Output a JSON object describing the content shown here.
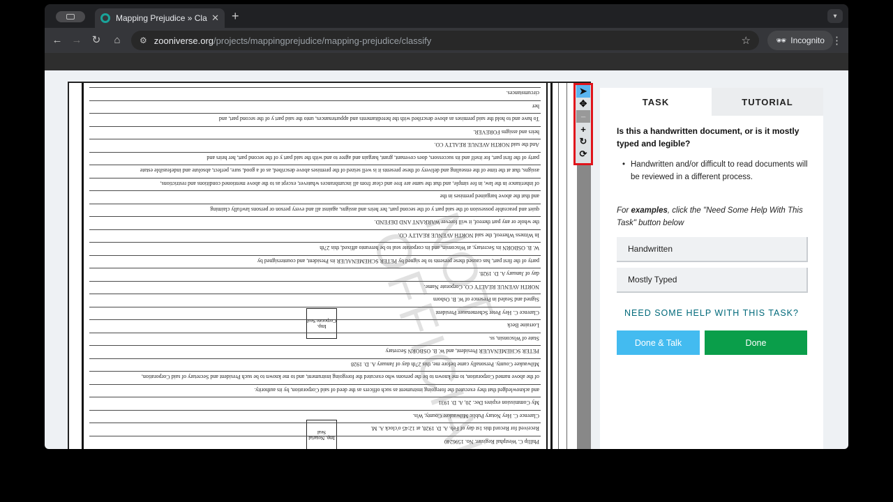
{
  "browser": {
    "tab_title": "Mapping Prejudice » Classify",
    "tab_close": "✕",
    "new_tab": "+",
    "url_domain": "zooniverse.org",
    "url_path": "/projects/mappingprejudice/mapping-prejudice/classify",
    "incognito_label": "Incognito"
  },
  "tools": [
    "pointer-icon",
    "move-icon",
    "zoom-out-icon",
    "zoom-in-icon",
    "rotate-icon",
    "reset-icon"
  ],
  "document": {
    "lines": [
      "Phillip C. Westphal    Register.    No. 1596240",
      "Received for Record this  1st  day of  Feb.  A. D. 1928, at 12:45 o'clock A. M.",
      "Clarence C. Hey        Notary Public Milwaukee County, Wis.",
      "My Commission expires Dec. 20, A. D. 1931",
      "and acknowledged that they executed the foregoing instrument as such officers as the deed of said Corporation, by its authority.",
      "of the above named Corporation, to me known to be the persons who executed the foregoing instrument, and to me known to be such President and Secretary of said Corporation,",
      "Milwaukee County.  Personally came before me, this 27th day of January A. D. 1928",
      "PETER SCHEMENAUER President, and W. B. OSBORN Secretary",
      "State of Wisconsin, ss.",
      "Lorraine Beck",
      "Clarence C. Hey         Peter Schemenauer   President",
      "Signed and Sealed in Presence of       W. B. Osborn",
      "NORTH AVENUE REALTY CO.      Corporate Name.",
      "day of January A. D. 1928.",
      "party of the first part, has caused these presents to be signed by PETER SCHEMENAUER its President, and countersigned by",
      "W. B. OSBORN its Secretary, at Wisconsin, and its corporate seal to be hereunto affixed, this 27th",
      "In Witness Whereof, the said NORTH AVENUE REALTY CO.",
      "the whole or any part thereof, it will forever WARRANT AND DEFEND.",
      "quiet and peaceable possession of the said part y of the second part, her heirs and assigns, against all and every person or persons lawfully claiming",
      "and that the above bargained premises in the",
      "of inheritance in the law, in fee simple, and that the same are free and clear from all incumbrances whatever, except as to the above mentioned conditions and restrictions,",
      "assigns, that at the time of the ensealing and delivery of these presents it is well seized of the premises above described, as of a good, sure, perfect, absolute and indefeasible estate",
      "party of the first part, for itself and its successors, does covenant, grant, bargain and agree to and with the said part y of the second part, her heirs and",
      "And the said NORTH AVENUE REALTY CO.",
      "heirs and assigns FOREVER.",
      "To have and to hold the said premises as above described with the hereditaments and appurtenances, unto the said part y of the second part, and",
      "her",
      "circumstances."
    ],
    "seal_1": "Imp. Notarial Seal",
    "seal_2": "Imp. Corporate Seal",
    "watermark": "NOT OFFICIAL"
  },
  "task": {
    "tab_task": "TASK",
    "tab_tutorial": "TUTORIAL",
    "question": "Is this a handwritten document, or is it mostly typed and legible?",
    "bullet": "Handwritten and/or difficult to read documents will be reviewed in a different process.",
    "example_prefix": "For ",
    "example_bold": "examples",
    "example_suffix": ", click the \"Need Some Help With This Task\" button below",
    "answers": [
      "Handwritten",
      "Mostly Typed"
    ],
    "help_link": "NEED SOME HELP WITH THIS TASK?",
    "done_talk": "Done & Talk",
    "done": "Done"
  }
}
